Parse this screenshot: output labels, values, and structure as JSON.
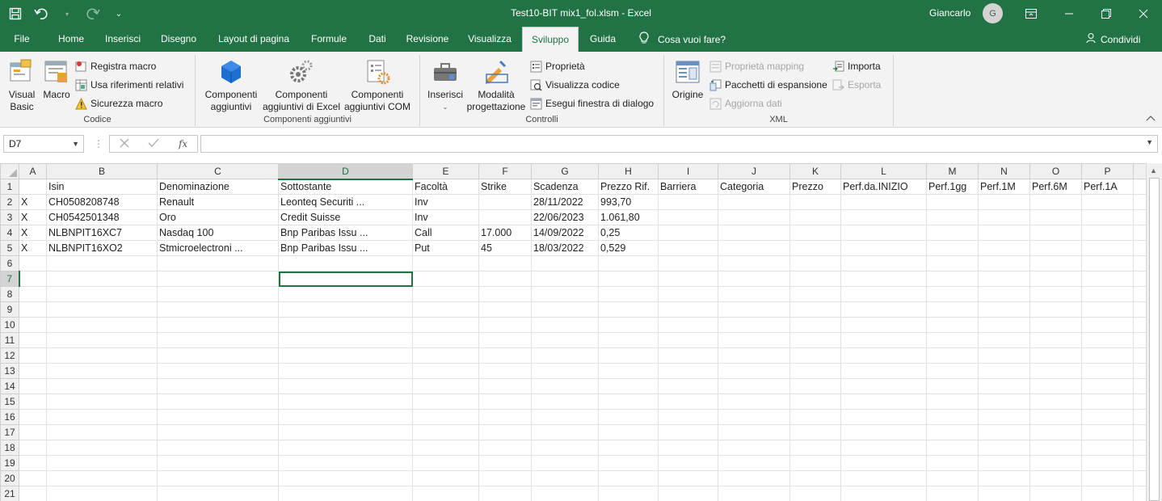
{
  "window": {
    "title": "Test10-BIT mix1_fol.xlsm  -  Excel",
    "user": "Giancarlo",
    "avatar_initial": "G"
  },
  "tabs": [
    {
      "label": "File"
    },
    {
      "label": "Home"
    },
    {
      "label": "Inserisci"
    },
    {
      "label": "Disegno"
    },
    {
      "label": "Layout di pagina"
    },
    {
      "label": "Formule"
    },
    {
      "label": "Dati"
    },
    {
      "label": "Revisione"
    },
    {
      "label": "Visualizza"
    },
    {
      "label": "Sviluppo"
    },
    {
      "label": "Guida"
    }
  ],
  "active_tab": "Sviluppo",
  "tell_me": "Cosa vuoi fare?",
  "share_label": "Condividi",
  "ribbon": {
    "codice": {
      "label": "Codice",
      "visual_basic_1": "Visual",
      "visual_basic_2": "Basic",
      "macro": "Macro",
      "registra_macro": "Registra macro",
      "usa_riferimenti": "Usa riferimenti relativi",
      "sicurezza_macro": "Sicurezza macro"
    },
    "componenti": {
      "label": "Componenti aggiuntivi",
      "comp_agg_1": "Componenti",
      "comp_agg_2": "aggiuntivi",
      "comp_excel_1": "Componenti",
      "comp_excel_2": "aggiuntivi di Excel",
      "comp_com_1": "Componenti",
      "comp_com_2": "aggiuntivi COM"
    },
    "controlli": {
      "label": "Controlli",
      "inserisci": "Inserisci",
      "modalita_1": "Modalità",
      "modalita_2": "progettazione",
      "proprieta": "Proprietà",
      "visualizza_codice": "Visualizza codice",
      "esegui_finestra": "Esegui finestra di dialogo"
    },
    "xml": {
      "label": "XML",
      "origine": "Origine",
      "proprieta_mapping": "Proprietà mapping",
      "pacchetti": "Pacchetti di espansione",
      "aggiorna_dati": "Aggiorna dati",
      "importa": "Importa",
      "esporta": "Esporta"
    }
  },
  "formula_bar": {
    "name_box": "D7",
    "formula": ""
  },
  "sheet": {
    "columns": [
      "A",
      "B",
      "C",
      "D",
      "E",
      "F",
      "G",
      "H",
      "I",
      "J",
      "K",
      "L",
      "M",
      "N",
      "O",
      "P"
    ],
    "selected_column": "D",
    "selected_row": 7,
    "rows": [
      [
        "",
        "Isin",
        "Denominazione",
        "Sottostante",
        "Facoltà",
        "Strike",
        "Scadenza",
        "Prezzo Rif.",
        "Barriera",
        "Categoria",
        "Prezzo",
        "Perf.da.INIZIO",
        "Perf.1gg",
        "Perf.1M",
        "Perf.6M",
        "Perf.1A"
      ],
      [
        "X",
        "CH0508208748",
        "Renault",
        "Leonteq Securiti ...",
        "Inv",
        "",
        "28/11/2022",
        "993,70",
        "",
        "",
        "",
        "",
        "",
        "",
        "",
        ""
      ],
      [
        "X",
        "CH0542501348",
        "Oro",
        "Credit Suisse",
        "Inv",
        "",
        "22/06/2023",
        "1.061,80",
        "",
        "",
        "",
        "",
        "",
        "",
        "",
        ""
      ],
      [
        "X",
        "NLBNPIT16XC7",
        "Nasdaq 100",
        "Bnp Paribas Issu ...",
        "Call",
        "17.000",
        "14/09/2022",
        "0,25",
        "",
        "",
        "",
        "",
        "",
        "",
        "",
        ""
      ],
      [
        "X",
        "NLBNPIT16XO2",
        "Stmicroelectroni ...",
        "Bnp Paribas Issu ...",
        "Put",
        "45",
        "18/03/2022",
        "0,529",
        "",
        "",
        "",
        "",
        "",
        "",
        "",
        ""
      ],
      [
        "",
        "",
        "",
        "",
        "",
        "",
        "",
        "",
        "",
        "",
        "",
        "",
        "",
        "",
        "",
        ""
      ],
      [
        "",
        "",
        "",
        "",
        "",
        "",
        "",
        "",
        "",
        "",
        "",
        "",
        "",
        "",
        "",
        ""
      ],
      [
        "",
        "",
        "",
        "",
        "",
        "",
        "",
        "",
        "",
        "",
        "",
        "",
        "",
        "",
        "",
        ""
      ],
      [
        "",
        "",
        "",
        "",
        "",
        "",
        "",
        "",
        "",
        "",
        "",
        "",
        "",
        "",
        "",
        ""
      ],
      [
        "",
        "",
        "",
        "",
        "",
        "",
        "",
        "",
        "",
        "",
        "",
        "",
        "",
        "",
        "",
        ""
      ],
      [
        "",
        "",
        "",
        "",
        "",
        "",
        "",
        "",
        "",
        "",
        "",
        "",
        "",
        "",
        "",
        ""
      ],
      [
        "",
        "",
        "",
        "",
        "",
        "",
        "",
        "",
        "",
        "",
        "",
        "",
        "",
        "",
        "",
        ""
      ],
      [
        "",
        "",
        "",
        "",
        "",
        "",
        "",
        "",
        "",
        "",
        "",
        "",
        "",
        "",
        "",
        ""
      ],
      [
        "",
        "",
        "",
        "",
        "",
        "",
        "",
        "",
        "",
        "",
        "",
        "",
        "",
        "",
        "",
        ""
      ],
      [
        "",
        "",
        "",
        "",
        "",
        "",
        "",
        "",
        "",
        "",
        "",
        "",
        "",
        "",
        "",
        ""
      ],
      [
        "",
        "",
        "",
        "",
        "",
        "",
        "",
        "",
        "",
        "",
        "",
        "",
        "",
        "",
        "",
        ""
      ],
      [
        "",
        "",
        "",
        "",
        "",
        "",
        "",
        "",
        "",
        "",
        "",
        "",
        "",
        "",
        "",
        ""
      ],
      [
        "",
        "",
        "",
        "",
        "",
        "",
        "",
        "",
        "",
        "",
        "",
        "",
        "",
        "",
        "",
        ""
      ],
      [
        "",
        "",
        "",
        "",
        "",
        "",
        "",
        "",
        "",
        "",
        "",
        "",
        "",
        "",
        "",
        ""
      ],
      [
        "",
        "",
        "",
        "",
        "",
        "",
        "",
        "",
        "",
        "",
        "",
        "",
        "",
        "",
        "",
        ""
      ],
      [
        "",
        "",
        "",
        "",
        "",
        "",
        "",
        "",
        "",
        "",
        "",
        "",
        "",
        "",
        "",
        ""
      ]
    ]
  },
  "colors": {
    "accent": "#217346"
  }
}
